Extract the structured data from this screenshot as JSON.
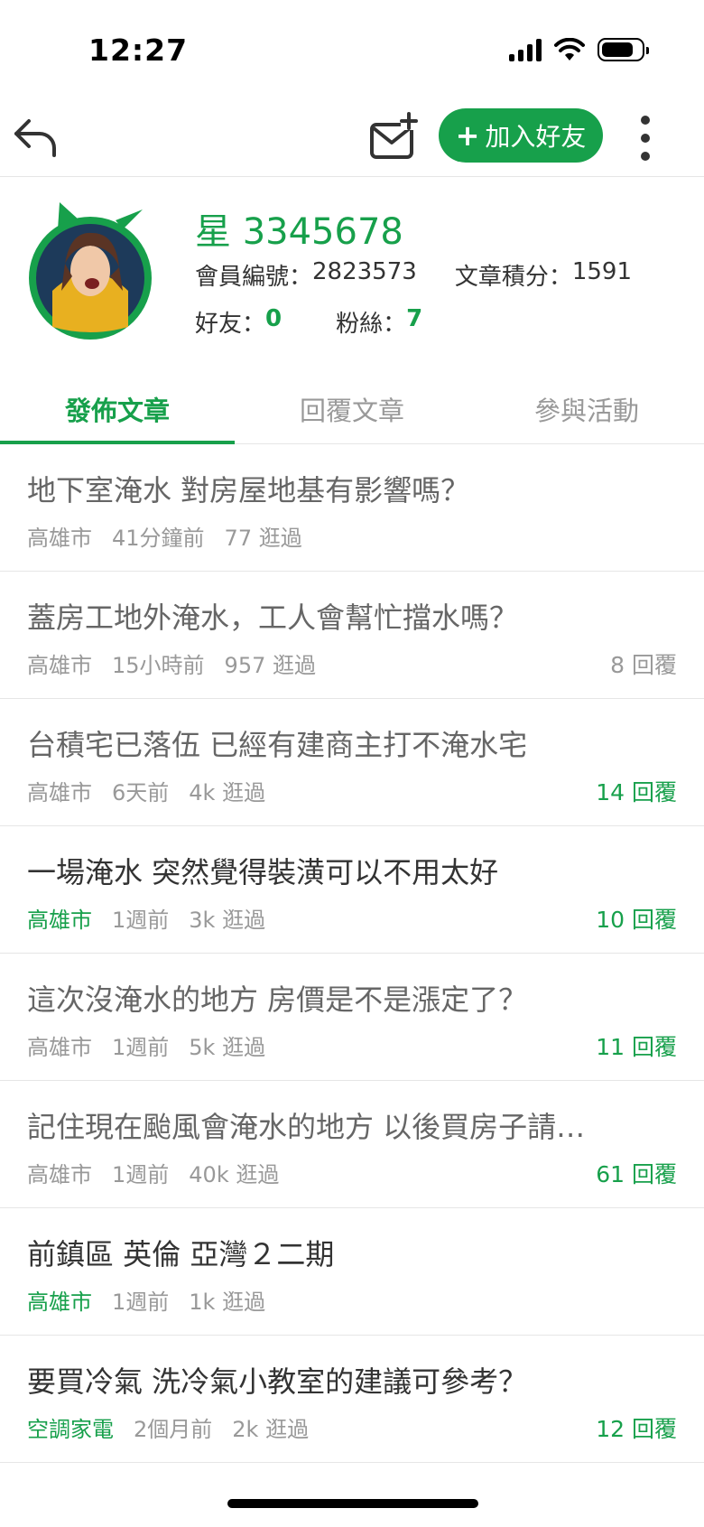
{
  "status_bar": {
    "time": "12:27",
    "battery_level": 0.8
  },
  "nav": {
    "add_friend_label": "加入好友",
    "add_friend_plus": "+"
  },
  "profile": {
    "name": "星 3345678",
    "member_label": "會員編號：",
    "member_id": "2823573",
    "score_label": "文章積分：",
    "score": "1591",
    "friends_label": "好友：",
    "friends": "0",
    "fans_label": "粉絲：",
    "fans": "7"
  },
  "tabs": [
    {
      "label": "發佈文章",
      "active": true
    },
    {
      "label": "回覆文章",
      "active": false
    },
    {
      "label": "參與活動",
      "active": false
    }
  ],
  "posts": [
    {
      "title": "地下室淹水 對房屋地基有影響嗎？",
      "category": "高雄市",
      "time": "41分鐘前",
      "views": "77 逛過",
      "replies": "",
      "title_style": "grey",
      "category_green": false,
      "replies_green": false
    },
    {
      "title": "蓋房工地外淹水，工人會幫忙擋水嗎？",
      "category": "高雄市",
      "time": "15小時前",
      "views": "957 逛過",
      "replies": "8 回覆",
      "title_style": "grey",
      "category_green": false,
      "replies_green": false
    },
    {
      "title": "台積宅已落伍 已經有建商主打不淹水宅",
      "category": "高雄市",
      "time": "6天前",
      "views": "4k 逛過",
      "replies": "14 回覆",
      "title_style": "grey",
      "category_green": false,
      "replies_green": true
    },
    {
      "title": "一場淹水 突然覺得裝潢可以不用太好",
      "category": "高雄市",
      "time": "1週前",
      "views": "3k 逛過",
      "replies": "10 回覆",
      "title_style": "dark",
      "category_green": true,
      "replies_green": true
    },
    {
      "title": "這次沒淹水的地方 房價是不是漲定了？",
      "category": "高雄市",
      "time": "1週前",
      "views": "5k 逛過",
      "replies": "11 回覆",
      "title_style": "grey",
      "category_green": false,
      "replies_green": true
    },
    {
      "title": "記住現在颱風會淹水的地方 以後買房子請…",
      "category": "高雄市",
      "time": "1週前",
      "views": "40k 逛過",
      "replies": "61 回覆",
      "title_style": "grey",
      "category_green": false,
      "replies_green": true
    },
    {
      "title": "前鎮區 英倫 亞灣２二期",
      "category": "高雄市",
      "time": "1週前",
      "views": "1k 逛過",
      "replies": "",
      "title_style": "dark",
      "category_green": true,
      "replies_green": false
    },
    {
      "title": "要買冷氣 洗冷氣小教室的建議可參考？",
      "category": "空調家電",
      "time": "2個月前",
      "views": "2k 逛過",
      "replies": "12 回覆",
      "title_style": "dark",
      "category_green": true,
      "replies_green": true
    }
  ],
  "colors": {
    "accent": "#17a04b",
    "muted": "#999999",
    "text": "#333333"
  },
  "icons": [
    "back-arrow-icon",
    "mail-plus-icon",
    "more-vertical-icon",
    "signal-icon",
    "wifi-icon",
    "battery-icon"
  ]
}
